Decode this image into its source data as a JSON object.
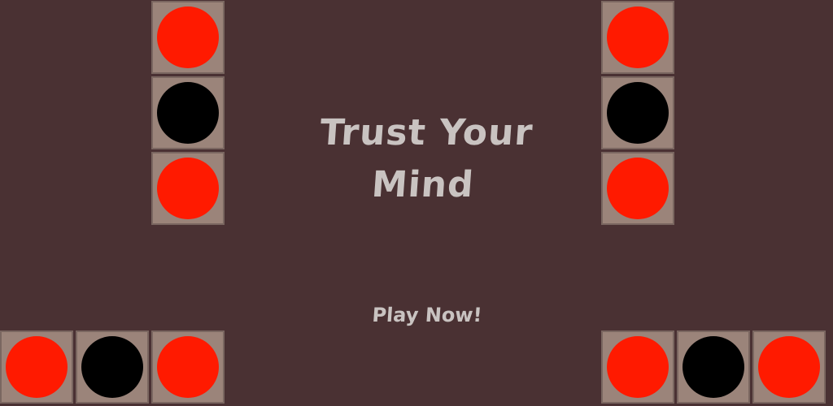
{
  "game": {
    "title_line1": "Trust Your",
    "title_line2": "Mind",
    "play_label": "Play Now!"
  },
  "colors": {
    "background": "#4a3133",
    "tile": "#9b847a",
    "tile_border": "#7a6660",
    "red_disc": "#ff1a00",
    "black_disc": "#000000",
    "title_text": "#c9c3c1"
  },
  "stacks": {
    "top_left": [
      "red",
      "black",
      "red"
    ],
    "top_right": [
      "red",
      "black",
      "red"
    ],
    "bottom_left": [
      "red",
      "black",
      "red"
    ],
    "bottom_right": [
      "red",
      "black",
      "red"
    ]
  }
}
